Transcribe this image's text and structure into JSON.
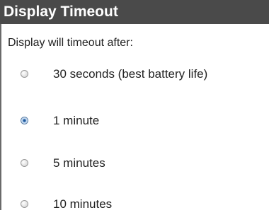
{
  "window": {
    "title": "Display Timeout"
  },
  "prompt": "Display will timeout after:",
  "options": [
    {
      "label": "30 seconds (best battery life)",
      "selected": false
    },
    {
      "label": "1 minute",
      "selected": true
    },
    {
      "label": "5 minutes",
      "selected": false
    },
    {
      "label": "10 minutes",
      "selected": false
    }
  ],
  "colors": {
    "title_bar_bg": "#4a4a4a",
    "title_text": "#ffffff",
    "radio_selected": "#2f6bb0"
  }
}
